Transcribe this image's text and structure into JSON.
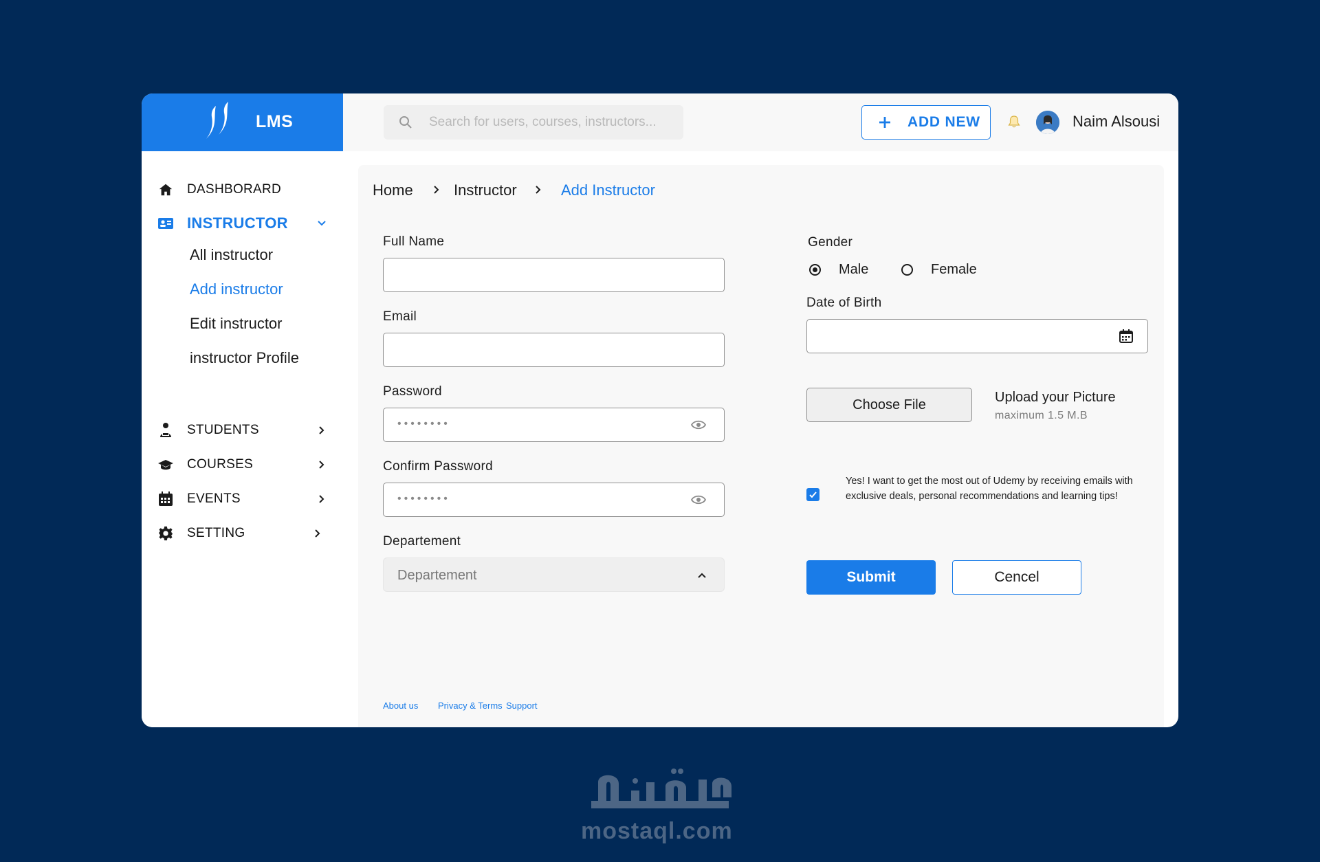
{
  "brand": {
    "name": "LMS",
    "accent": "#1a7ce8",
    "background": "#012957"
  },
  "sidebar": {
    "items": [
      {
        "label": "DASHBORARD",
        "icon": "home-icon"
      },
      {
        "label": "INSTRUCTOR",
        "icon": "id-card-icon",
        "expanded": true
      },
      {
        "label": "STUDENTS",
        "icon": "student-icon"
      },
      {
        "label": "COURSES",
        "icon": "graduation-cap-icon"
      },
      {
        "label": "EVENTS",
        "icon": "calendar-icon"
      },
      {
        "label": "SETTING",
        "icon": "gear-icon"
      }
    ],
    "instructor_sub": [
      {
        "label": "All instructor"
      },
      {
        "label": "Add instructor",
        "active": true
      },
      {
        "label": "Edit instructor"
      },
      {
        "label": "instructor Profile"
      }
    ]
  },
  "header": {
    "search_placeholder": "Search for users, courses, instructors...",
    "add_new_label": "ADD NEW",
    "user_name": "Naim Alsousi"
  },
  "breadcrumb": [
    "Home",
    "Instructor",
    "Add Instructor"
  ],
  "form": {
    "full_name_label": "Full Name",
    "email_label": "Email",
    "password_label": "Password",
    "password_mask": "••••••••",
    "confirm_password_label": "Confirm Password",
    "confirm_password_mask": "••••••••",
    "department_label": "Departement",
    "department_value": "Departement",
    "gender_label": "Gender",
    "gender_options": [
      "Male",
      "Female"
    ],
    "gender_selected": "Male",
    "dob_label": "Date of Birth",
    "choose_file_label": "Choose File",
    "upload_title": "Upload your Picture",
    "upload_hint": "maximum 1.5 M.B",
    "consent_checked": true,
    "consent_text": "Yes! I want to get the most out of Udemy by receiving emails with exclusive deals, personal recommendations and learning tips!",
    "submit_label": "Submit",
    "cancel_label": "Cencel"
  },
  "footer": {
    "links": [
      "About us",
      "Privacy & Terms",
      "Support"
    ]
  },
  "watermark": {
    "latin": "mostaql.com",
    "arabic": "مستقل"
  }
}
